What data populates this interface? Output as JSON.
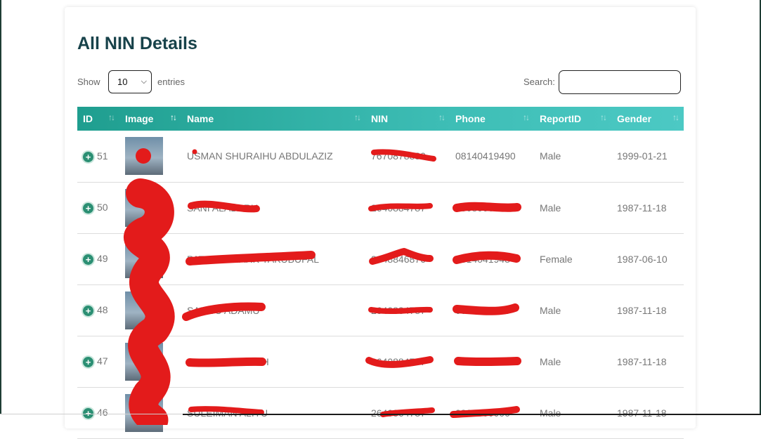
{
  "page": {
    "title": "All NIN Details"
  },
  "controls": {
    "show_label": "Show",
    "entries_value": "10",
    "entries_label": "entries",
    "search_label": "Search:",
    "search_value": ""
  },
  "table": {
    "headers": [
      "ID",
      "Image",
      "Name",
      "NIN",
      "Phone",
      "ReportID",
      "Gender"
    ],
    "rows": [
      {
        "id": "51",
        "name": "USMAN SHURAIHU ABDULAZIZ",
        "nin": "7670878880",
        "phone": "08140419490",
        "report": "Male",
        "gender": "1999-01-21"
      },
      {
        "id": "50",
        "name": "SANI ALABARU",
        "nin": "2640884787",
        "phone": "08080000000",
        "report": "Male",
        "gender": "1987-11-18"
      },
      {
        "id": "49",
        "name": "PATRICK MARK YAKUBUFAL",
        "nin": "2648846876",
        "phone": "0814041948",
        "report": "Female",
        "gender": "1987-06-10"
      },
      {
        "id": "48",
        "name": "SALISU ADAMU",
        "nin": "2640884787",
        "phone": "0806800470",
        "report": "Male",
        "gender": "1987-11-18"
      },
      {
        "id": "47",
        "name": "MUSA ABDULLAH",
        "nin": "2640884757",
        "phone": "0806800000",
        "report": "Male",
        "gender": "1987-11-18"
      },
      {
        "id": "46",
        "name": "SULEIMAN ALIYU",
        "nin": "2640864787",
        "phone": "0806800000",
        "report": "Male",
        "gender": "1987-11-18"
      }
    ]
  }
}
